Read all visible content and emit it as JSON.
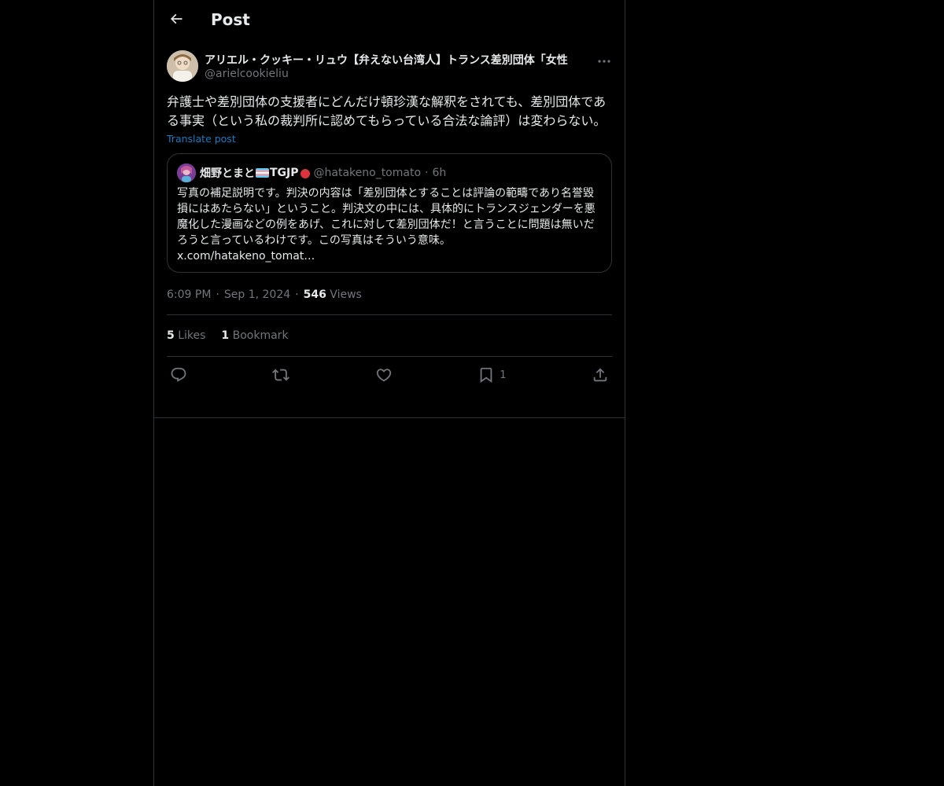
{
  "header": {
    "title": "Post"
  },
  "post": {
    "author_name": "アリエル・クッキー・リュウ【弁えない台湾人】トランス差別団体「女性",
    "author_handle": "@arielcookieliu",
    "text": "弁護士や差別団体の支援者にどんだけ頓珍漢な解釈をされても、差別団体である事実（という私の裁判所に認めてもらっている合法な論評）は変わらない。",
    "translate_label": "Translate post",
    "timestamp_time": "6:09 PM",
    "timestamp_date": "Sep 1, 2024",
    "views_count": "546",
    "views_label": "Views",
    "separator": "·"
  },
  "quote": {
    "name": "畑野とまと",
    "name_suffix": "TGJP",
    "handle": "@hatakeno_tomato",
    "time": "6h",
    "separator": "·",
    "text": "写真の補足説明です。判決の内容は「差別団体とすることは評論の範疇であり名誉毀損にはあたらない」ということ。判決文の中には、具体的にトランスジェンダーを悪魔化した漫画などの例をあげ、これに対して差別団体だ！と言うことに問題は無いだろうと言っているわけです。この写真はそういう意味。",
    "link": "x.com/hatakeno_tomat…"
  },
  "stats": {
    "likes_count": "5",
    "likes_label": "Likes",
    "bookmarks_count": "1",
    "bookmarks_label": "Bookmark"
  },
  "actions": {
    "bookmark_count": "1",
    "icons": [
      "reply-icon",
      "repost-icon",
      "like-icon",
      "bookmark-icon",
      "share-icon"
    ]
  },
  "colors": {
    "background": "#000000",
    "text": "#e7e9ea",
    "secondary": "#71767b",
    "accent": "#1d9bf0",
    "border": "#2f3336"
  }
}
